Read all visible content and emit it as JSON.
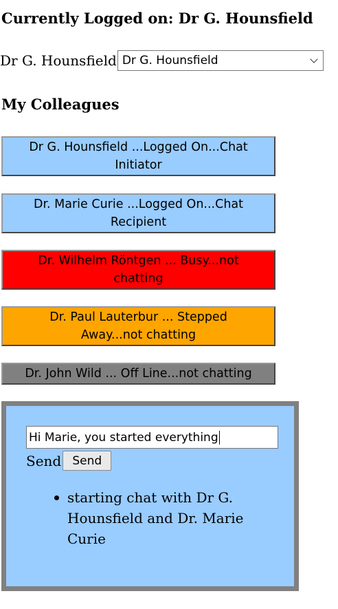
{
  "current_user": {
    "heading": "Currently Logged on: Dr G. Hounsfield",
    "label": "Dr G. Hounsfield",
    "select_value": "Dr G. Hounsfield"
  },
  "colleagues": {
    "heading": "My Colleagues",
    "items": [
      {
        "label": "Dr G. Hounsfield ...Logged On...Chat Initiator",
        "color": "#99ccff"
      },
      {
        "label": "Dr. Marie Curie ...Logged On...Chat Recipient",
        "color": "#99ccff"
      },
      {
        "label": "Dr. Wilhelm Röntgen ... Busy...not chatting",
        "color": "#ff0000"
      },
      {
        "label": "Dr. Paul Lauterbur ... Stepped Away...not chatting",
        "color": "#ffa500"
      },
      {
        "label": "Dr. John Wild ... Off Line...not chatting",
        "color": "#808080"
      }
    ]
  },
  "chat": {
    "input_value": "Hi Marie, you started everything",
    "send_label": "Send",
    "send_button": "Send",
    "messages": [
      "starting chat with Dr G. Hounsfield and Dr. Marie Curie"
    ]
  }
}
